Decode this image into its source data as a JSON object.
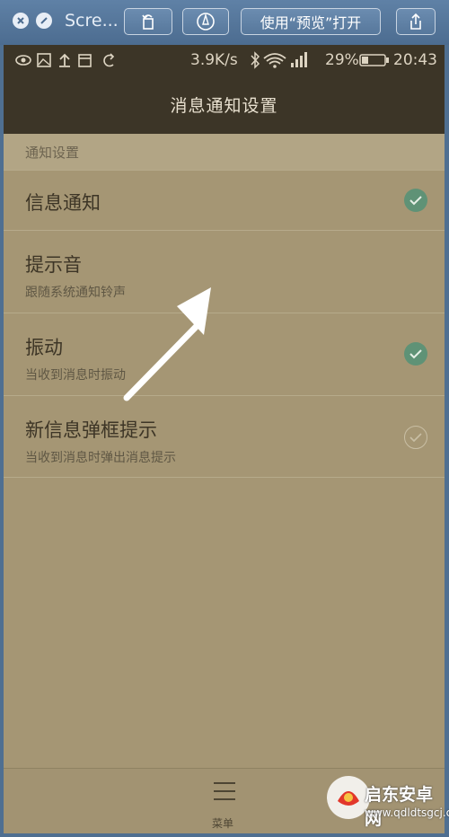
{
  "mac_toolbar": {
    "title": "Scre...",
    "open_with_preview_label": "使用“预览”打开"
  },
  "status_bar": {
    "speed": "3.9K/s",
    "battery": "29%",
    "time": "20:43"
  },
  "app_bar": {
    "title": "消息通知设置"
  },
  "section": {
    "label": "通知设置"
  },
  "settings": [
    {
      "title": "信息通知",
      "subtitle": "",
      "checked": true
    },
    {
      "title": "提示音",
      "subtitle": "跟随系统通知铃声",
      "checked": null
    },
    {
      "title": "振动",
      "subtitle": "当收到消息时振动",
      "checked": true
    },
    {
      "title": "新信息弹框提示",
      "subtitle": "当收到消息时弹出消息提示",
      "checked": false
    }
  ],
  "bottom_nav": {
    "menu_label": "菜单"
  },
  "watermark": {
    "brand": "启东安卓网",
    "url": "www.qdldtsgcj.com"
  },
  "colors": {
    "panel": "#a59674",
    "dark_bar": "#3c3527",
    "check_on": "#5f9276"
  }
}
